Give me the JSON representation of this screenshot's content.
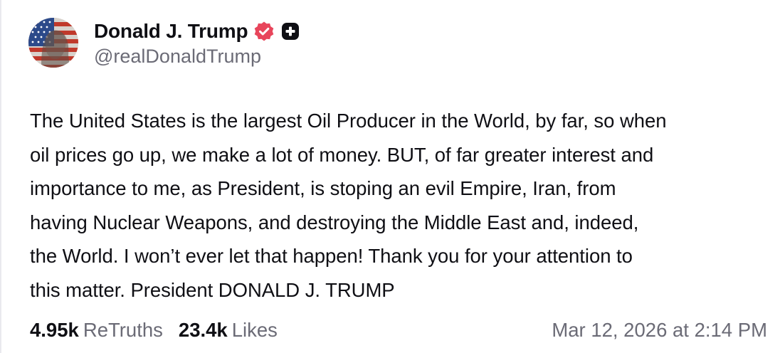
{
  "author": {
    "display_name": "Donald J. Trump",
    "handle": "@realDonaldTrump",
    "avatar_icon": "avatar-flag-portrait",
    "verified_icon": "verified-badge-icon",
    "verified_color": "#e8455b",
    "plus_icon": "plus-badge-icon"
  },
  "post": {
    "text": "The United States is the largest Oil Producer in the World, by far, so when oil prices go up, we make a lot of money. BUT, of far greater interest and importance to me, as President, is stoping an evil Empire, Iran, from having Nuclear Weapons, and destroying the Middle East and, indeed, the World. I won’t ever let that happen! Thank you for your attention to this matter. President DONALD J. TRUMP",
    "lines": [
      "The United States is the largest Oil Producer in the World, by far, so when",
      "oil prices go up, we make a lot of money. BUT, of far greater interest and",
      "importance to me, as President, is stoping an evil Empire, Iran, from",
      "having Nuclear Weapons, and destroying the Middle East and, indeed,",
      "the World. I won’t ever let that happen! Thank you for your attention to",
      "this matter. President DONALD J. TRUMP"
    ]
  },
  "stats": {
    "retruths_count": "4.95k",
    "retruths_label": "ReTruths",
    "likes_count": "23.4k",
    "likes_label": "Likes",
    "timestamp": "Mar 12, 2026 at 2:14 PM"
  }
}
